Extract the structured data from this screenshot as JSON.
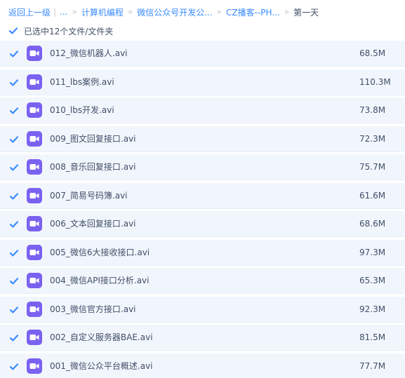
{
  "breadcrumb": {
    "back": "返回上一级",
    "ellipsis": "...",
    "items": [
      "计算机编程",
      "微信公众号开发公...",
      "CZ播客--PH..."
    ],
    "current": "第一天"
  },
  "selection": {
    "label": "已选中12个文件/文件夹",
    "checked": true
  },
  "colors": {
    "accent": "#3b8cff",
    "row_bg": "#f1f6fd",
    "video_icon": "#7a61f0",
    "text": "#424e67"
  },
  "files": [
    {
      "name": "012_微信机器人.avi",
      "size": "68.5M",
      "icon": "video-file-icon",
      "checked": true
    },
    {
      "name": "011_lbs案例.avi",
      "size": "110.3M",
      "icon": "video-file-icon",
      "checked": true
    },
    {
      "name": "010_lbs开发.avi",
      "size": "73.8M",
      "icon": "video-file-icon",
      "checked": true
    },
    {
      "name": "009_图文回复接口.avi",
      "size": "72.3M",
      "icon": "video-file-icon",
      "checked": true
    },
    {
      "name": "008_音乐回复接口.avi",
      "size": "75.7M",
      "icon": "video-file-icon",
      "checked": true
    },
    {
      "name": "007_简易号码簿.avi",
      "size": "61.6M",
      "icon": "video-file-icon",
      "checked": true
    },
    {
      "name": "006_文本回复接口.avi",
      "size": "68.6M",
      "icon": "video-file-icon",
      "checked": true
    },
    {
      "name": "005_微信6大接收接口.avi",
      "size": "97.3M",
      "icon": "video-file-icon",
      "checked": true
    },
    {
      "name": "004_微信API接口分析.avi",
      "size": "65.3M",
      "icon": "video-file-icon",
      "checked": true
    },
    {
      "name": "003_微信官方接口.avi",
      "size": "92.3M",
      "icon": "video-file-icon",
      "checked": true
    },
    {
      "name": "002_自定义服务器BAE.avi",
      "size": "81.5M",
      "icon": "video-file-icon",
      "checked": true
    },
    {
      "name": "001_微信公众平台概述.avi",
      "size": "77.7M",
      "icon": "video-file-icon",
      "checked": true
    }
  ]
}
